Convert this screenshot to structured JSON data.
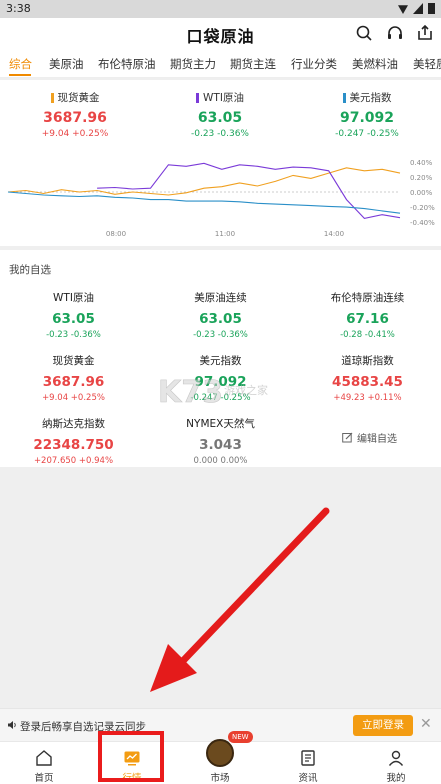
{
  "status_bar": {
    "time": "3:38"
  },
  "header": {
    "logo": "口袋原油"
  },
  "tabs": [
    {
      "label": "综合",
      "active": true
    },
    {
      "label": "美原油"
    },
    {
      "label": "布伦特原油"
    },
    {
      "label": "期货主力"
    },
    {
      "label": "期货主连"
    },
    {
      "label": "行业分类"
    },
    {
      "label": "美燃料油"
    },
    {
      "label": "美轻质"
    }
  ],
  "quotes": [
    {
      "name": "现货黄金",
      "price": "3687.96",
      "change": "+9.04 +0.25%",
      "trend": "up",
      "color": "#f0a020"
    },
    {
      "name": "WTI原油",
      "price": "63.05",
      "change": "-0.23 -0.36%",
      "trend": "down",
      "color": "#7a3ad8"
    },
    {
      "name": "美元指数",
      "price": "97.092",
      "change": "-0.247 -0.25%",
      "trend": "down",
      "color": "#2a8fc8"
    }
  ],
  "chart_data": {
    "type": "line",
    "x_ticks": [
      "08:00",
      "11:00",
      "14:00"
    ],
    "y_ticks": [
      "0.40%",
      "0.20%",
      "0.00%",
      "-0.20%",
      "-0.40%"
    ],
    "ylim": [
      -0.45,
      0.45
    ],
    "series": [
      {
        "name": "现货黄金",
        "color": "#f0a020",
        "values": [
          0.0,
          0.02,
          -0.02,
          0.03,
          0.0,
          0.02,
          -0.03,
          0.0,
          -0.02,
          -0.04,
          -0.01,
          0.05,
          0.07,
          0.12,
          0.08,
          0.14,
          0.22,
          0.18,
          0.25,
          0.32,
          0.28,
          0.3,
          0.25
        ]
      },
      {
        "name": "WTI原油",
        "color": "#7a3ad8",
        "values": [
          null,
          null,
          null,
          null,
          null,
          0.05,
          0.06,
          0.04,
          0.05,
          0.36,
          0.34,
          0.38,
          0.3,
          0.36,
          0.34,
          0.3,
          0.33,
          0.32,
          0.28,
          -0.1,
          -0.35,
          -0.3,
          -0.34
        ]
      },
      {
        "name": "美元指数",
        "color": "#2a8fc8",
        "values": [
          0.0,
          -0.02,
          -0.04,
          -0.05,
          -0.06,
          -0.05,
          -0.07,
          -0.08,
          -0.1,
          -0.1,
          -0.12,
          -0.12,
          -0.12,
          -0.13,
          -0.15,
          -0.16,
          -0.17,
          -0.18,
          -0.19,
          -0.2,
          -0.22,
          -0.25,
          -0.28
        ]
      }
    ]
  },
  "watchlist": {
    "title": "我的自选",
    "items": [
      {
        "name": "WTI原油",
        "price": "63.05",
        "change": "-0.23 -0.36%",
        "trend": "down"
      },
      {
        "name": "美原油连续",
        "price": "63.05",
        "change": "-0.23 -0.36%",
        "trend": "down"
      },
      {
        "name": "布伦特原油连续",
        "price": "67.16",
        "change": "-0.28 -0.41%",
        "trend": "down"
      },
      {
        "name": "现货黄金",
        "price": "3687.96",
        "change": "+9.04 +0.25%",
        "trend": "up"
      },
      {
        "name": "美元指数",
        "price": "97.092",
        "change": "-0.247 -0.25%",
        "trend": "down"
      },
      {
        "name": "道琼斯指数",
        "price": "45883.45",
        "change": "+49.23 +0.11%",
        "trend": "up"
      },
      {
        "name": "纳斯达克指数",
        "price": "22348.750",
        "change": "+207.650 +0.94%",
        "trend": "up"
      },
      {
        "name": "NYMEX天然气",
        "price": "3.043",
        "change": "0.000 0.00%",
        "trend": "flat"
      }
    ],
    "edit_label": "编辑自选"
  },
  "watermark": {
    "text": "K73",
    "sub": "游戏之家"
  },
  "login_bar": {
    "text": "登录后畅享自选记录云同步",
    "button": "立即登录"
  },
  "bottom_nav": [
    {
      "label": "首页"
    },
    {
      "label": "行情",
      "active": true
    },
    {
      "label": "市场",
      "badge": "NEW"
    },
    {
      "label": "资讯"
    },
    {
      "label": "我的"
    }
  ]
}
